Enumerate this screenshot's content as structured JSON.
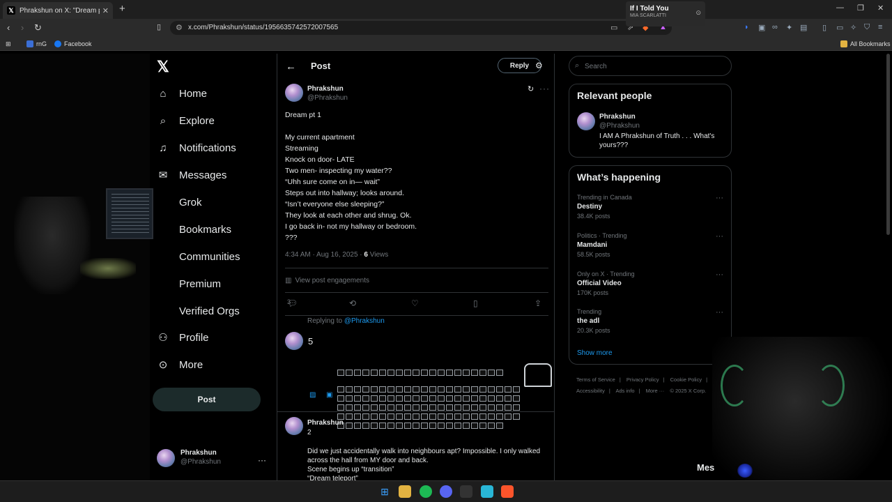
{
  "browser": {
    "tab_title": "Phrakshun on X: \"Dream pt 1 My...",
    "url": "x.com/Phrakshun/status/1956635742572007565",
    "bookmarks": [
      "rnG",
      "Facebook"
    ],
    "all_bookmarks": "All Bookmarks",
    "media": {
      "title": "If I Told You",
      "artist": "MIA SCARLATTI"
    }
  },
  "nav": {
    "items": [
      "Home",
      "Explore",
      "Notifications",
      "Messages",
      "Grok",
      "Bookmarks",
      "Communities",
      "Premium",
      "Verified Orgs",
      "Profile",
      "More"
    ],
    "post_label": "Post",
    "account": {
      "name": "Phrakshun",
      "handle": "@Phrakshun"
    }
  },
  "post": {
    "header_title": "Post",
    "reply_label": "Reply",
    "author_name": "Phrakshun",
    "author_handle": "@Phrakshun",
    "lines": [
      "Dream pt 1",
      "",
      "My current apartment",
      "Streaming",
      "Knock on door- LATE",
      "Two men- inspecting my water??",
      "“Uhh sure come on in— wait”",
      "Steps out into hallway; looks around.",
      "“Isn’t everyone else sleeping?”",
      "They look at each other and shrug. Ok.",
      "I go back in- not my hallway or bedroom.",
      "???"
    ],
    "timestamp": "4:34 AM · Aug 16, 2025 · ",
    "views_count": "6",
    "views_label": " Views",
    "engagements": "View post engagements",
    "reply_count": "3"
  },
  "compose": {
    "replying_prefix": "Replying to ",
    "replying_handle": "@Phrakshun",
    "input_value": "5"
  },
  "reply2": {
    "name": "Phrakshun",
    "number": "2",
    "text": "Did we just accidentally walk into neighbours apt? Impossible. I only walked across the hall from MY door and back.\nScene begins up “transition”\n“Dream teleport”"
  },
  "right": {
    "search_placeholder": "Search",
    "relevant_title": "Relevant people",
    "relevant": {
      "name": "Phrakshun",
      "handle": "@Phrakshun",
      "bio": "I AM A Phrakshun of Truth . . . What's yours???"
    },
    "happening_title": "What’s happening",
    "trends": [
      {
        "context": "Trending in Canada",
        "topic": "Destiny",
        "posts": "38.4K posts"
      },
      {
        "context": "Politics · Trending",
        "topic": "Mamdani",
        "posts": "58.5K posts"
      },
      {
        "context": "Only on X · Trending",
        "topic": "Official Video",
        "posts": "170K posts"
      },
      {
        "context": "Trending",
        "topic": "the adl",
        "posts": "20.3K posts"
      }
    ],
    "show_more": "Show more",
    "footer": [
      "Terms of Service",
      "|",
      "Privacy Policy",
      "|",
      "Cookie Policy",
      "|",
      "Accessibility",
      "|",
      "Ads info",
      "|",
      "More ···",
      "© 2025 X Corp."
    ]
  },
  "overlay": {
    "mes_text": "Mes"
  },
  "colors": {
    "accent": "#1d9bf0",
    "bg": "#000000",
    "border": "#2f3336",
    "muted": "#71767b"
  }
}
